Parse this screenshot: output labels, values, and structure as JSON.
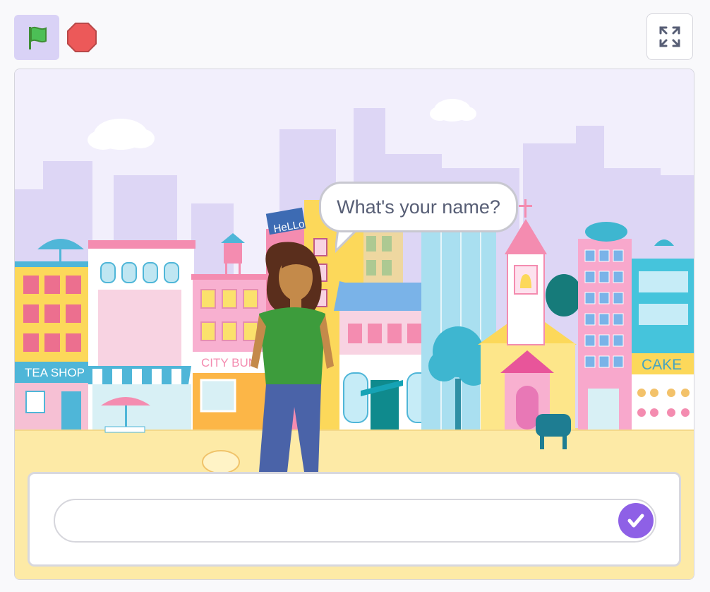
{
  "controls": {
    "green_flag_icon": "green-flag-icon",
    "stop_icon": "stop-sign-icon",
    "fullscreen_icon": "fullscreen-icon"
  },
  "stage": {
    "speech_bubble": "What's your name?",
    "signs": {
      "hello": "HeLLo",
      "tea_shop": "TEA SHOP",
      "city_bun": "CITY BUN",
      "cake": "CAKE"
    }
  },
  "ask": {
    "input_value": "",
    "submit_icon": "check-icon"
  },
  "colors": {
    "accent": "#8e60e6",
    "flag_bg": "#d9d2f6",
    "sky": "#f2effc",
    "skyline": "#ddd6f5",
    "ground": "#fdeaa6"
  }
}
